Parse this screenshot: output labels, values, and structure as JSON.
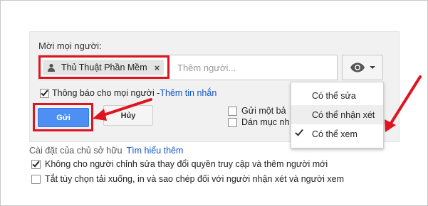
{
  "share": {
    "invite_label": "Mời mọi người:",
    "chip_name": "Thủ Thuật Phần Mềm",
    "chip_remove": "×",
    "add_placeholder": "Thêm người...",
    "notify_label": "Thông báo cho mọi người - ",
    "add_message_link": "Thêm tin nhắn",
    "send_label": "Gửi",
    "cancel_label": "Hủy",
    "send_copy_label": "Gửi một bả",
    "paste_label": "Dán mục nh",
    "notify_checked": true,
    "send_copy_checked": false,
    "paste_checked": false
  },
  "permission_menu": {
    "items": [
      {
        "label": "Có thể sửa",
        "selected": false,
        "hover": false
      },
      {
        "label": "Có thể nhận xét",
        "selected": false,
        "hover": true
      },
      {
        "label": "Có thể xem",
        "selected": true,
        "hover": false
      }
    ],
    "current_icon": "eye-icon"
  },
  "owner_settings": {
    "label": "Cài đặt của chủ sở hữu",
    "learn_more_link": "Tìm hiểu thêm",
    "options": [
      {
        "label": "Không cho người chỉnh sửa thay đổi quyền truy cập và thêm người mới",
        "checked": true
      },
      {
        "label": "Tắt tùy chọn tải xuống, in và sao chép đối với người nhận xét và người xem",
        "checked": false
      }
    ]
  },
  "colors": {
    "annotation_red": "#e0141e",
    "send_blue": "#4d8ff3",
    "link_blue": "#1155cc"
  }
}
